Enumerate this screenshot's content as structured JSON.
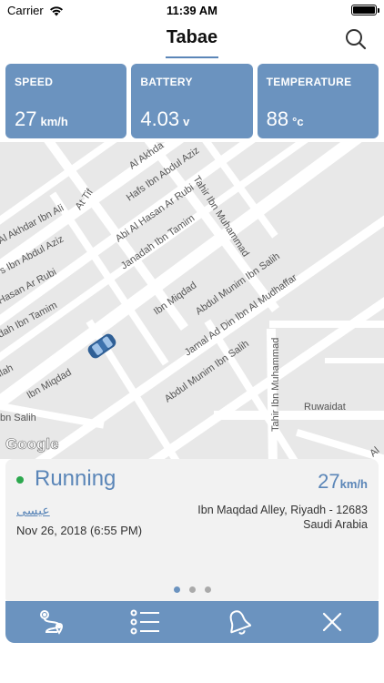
{
  "status_bar": {
    "carrier": "Carrier",
    "time": "11:39 AM"
  },
  "nav": {
    "title": "Tabae"
  },
  "cards": [
    {
      "label": "SPEED",
      "value": "27",
      "unit": "km/h"
    },
    {
      "label": "BATTERY",
      "value": "4.03",
      "unit": "v"
    },
    {
      "label": "TEMPERATURE",
      "value": "88",
      "unit": "°c"
    }
  ],
  "map": {
    "streets": [
      "Al Akhda",
      "Hafs Ibn Abdul Aziz",
      "At Tif",
      "Tahir Ibn Muhammad",
      "Abi Al Hasan Ar Rubi",
      "Al Akhdar Ibn Ali",
      "s Ibn Abdul Aziz",
      "Janadah Ibn Tamim",
      "Hasan Ar Rubi",
      "Abdul Munim Ibn Salih",
      "Ibn Miqdad",
      "dah Ibn Tamim",
      "Jamal Ad Din Ibn Al Mudhaffar",
      "Abdul Munim Ibn Salih",
      "Ibn Miqdad",
      "Tahir Ibn Muhammad",
      "Ruwaidat",
      "llah",
      "bn Salih",
      "Al"
    ],
    "logo": "Google"
  },
  "info": {
    "status": "Running",
    "speed_value": "27",
    "speed_unit": "km/h",
    "driver": "عيسى",
    "timestamp": "Nov 26, 2018 (6:55 PM)",
    "address_line1": "Ibn Maqdad Alley, Riyadh - 12683",
    "address_line2": "Saudi Arabia",
    "status_color": "#2ca84e"
  },
  "colors": {
    "accent": "#6b93bf",
    "text_accent": "#5b86b8"
  },
  "tabs": [
    {
      "icon": "route-icon"
    },
    {
      "icon": "list-icon"
    },
    {
      "icon": "bell-icon"
    },
    {
      "icon": "close-icon"
    }
  ]
}
